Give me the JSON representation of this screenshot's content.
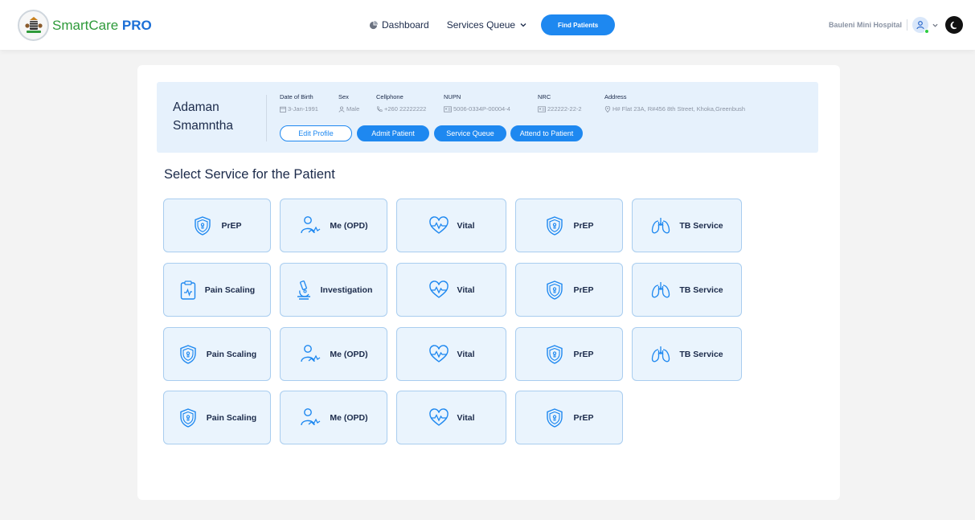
{
  "header": {
    "brand_main": "SmartCare",
    "brand_suffix": "PRO",
    "nav": {
      "dashboard": "Dashboard",
      "services_queue": "Services Queue",
      "find_patients": "Find Patients"
    },
    "hospital": "Bauleni Mini Hospital"
  },
  "patient": {
    "first_name": "Adaman",
    "last_name": "Smamntha",
    "fields": {
      "dob_label": "Date of Birth",
      "dob": "3-Jan-1991",
      "sex_label": "Sex",
      "sex": "Male",
      "cell_label": "Cellphone",
      "cell": "+260 22222222",
      "nupn_label": "NUPN",
      "nupn": "5006-0334P-00004-4",
      "nrc_label": "NRC",
      "nrc": "222222-22-2",
      "address_label": "Address",
      "address": "H# Flat 23A, R#456 8th Street, Khoka,Greenbush"
    },
    "buttons": {
      "edit": "Edit Profile",
      "admit": "Admit Patient",
      "queue": "Service Queue",
      "attend": "Attend to Patient"
    }
  },
  "section_title": "Select Service for the Patient",
  "services": [
    {
      "label": "PrEP",
      "icon": "shield-icon"
    },
    {
      "label": "Me (OPD)",
      "icon": "patient-icon"
    },
    {
      "label": "Vital",
      "icon": "heartbeat-icon"
    },
    {
      "label": "PrEP",
      "icon": "shield-icon"
    },
    {
      "label": "TB Service",
      "icon": "lungs-icon"
    },
    {
      "label": "Pain Scaling",
      "icon": "clipboard-icon"
    },
    {
      "label": "Investigation",
      "icon": "microscope-icon"
    },
    {
      "label": "Vital",
      "icon": "heartbeat-icon"
    },
    {
      "label": "PrEP",
      "icon": "shield-icon"
    },
    {
      "label": "TB Service",
      "icon": "lungs-icon"
    },
    {
      "label": "Pain Scaling",
      "icon": "shield-icon"
    },
    {
      "label": "Me (OPD)",
      "icon": "patient-icon"
    },
    {
      "label": "Vital",
      "icon": "heartbeat-icon"
    },
    {
      "label": "PrEP",
      "icon": "shield-icon"
    },
    {
      "label": "TB Service",
      "icon": "lungs-icon"
    },
    {
      "label": "Pain Scaling",
      "icon": "shield-icon"
    },
    {
      "label": "Me (OPD)",
      "icon": "patient-icon"
    },
    {
      "label": "Vital",
      "icon": "heartbeat-icon"
    },
    {
      "label": "PrEP",
      "icon": "shield-icon"
    }
  ],
  "colors": {
    "primary": "#1e88f0",
    "brand_green": "#2e9a3a",
    "tile_bg": "#eaf4fd",
    "tile_border": "#a9cdef",
    "patient_bg": "#e6f1fc"
  }
}
